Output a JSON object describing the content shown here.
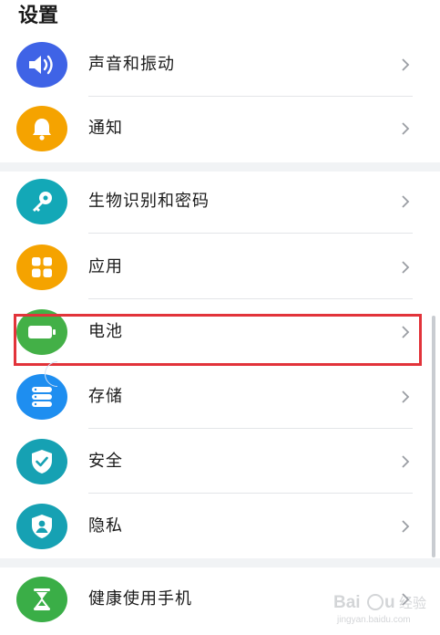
{
  "page": {
    "title": "设置"
  },
  "items": [
    {
      "label": "声音和振动",
      "icon": "speaker-icon",
      "color": "#3f63e6"
    },
    {
      "label": "通知",
      "icon": "bell-icon",
      "color": "#f5a300"
    },
    {
      "label": "生物识别和密码",
      "icon": "key-icon",
      "color": "#13a8b7"
    },
    {
      "label": "应用",
      "icon": "apps-grid-icon",
      "color": "#f5a300"
    },
    {
      "label": "电池",
      "icon": "battery-icon",
      "color": "#43b047"
    },
    {
      "label": "存储",
      "icon": "storage-icon",
      "color": "#1e8ef0"
    },
    {
      "label": "安全",
      "icon": "shield-check-icon",
      "color": "#16a1b3"
    },
    {
      "label": "隐私",
      "icon": "privacy-shield-icon",
      "color": "#16a1b3"
    },
    {
      "label": "健康使用手机",
      "icon": "hourglass-icon",
      "color": "#3aae47"
    }
  ],
  "highlight_color": "#e2333a",
  "watermark": {
    "brand": "Baidu",
    "cn": "经验",
    "url": "jingyan.baidu.com"
  }
}
